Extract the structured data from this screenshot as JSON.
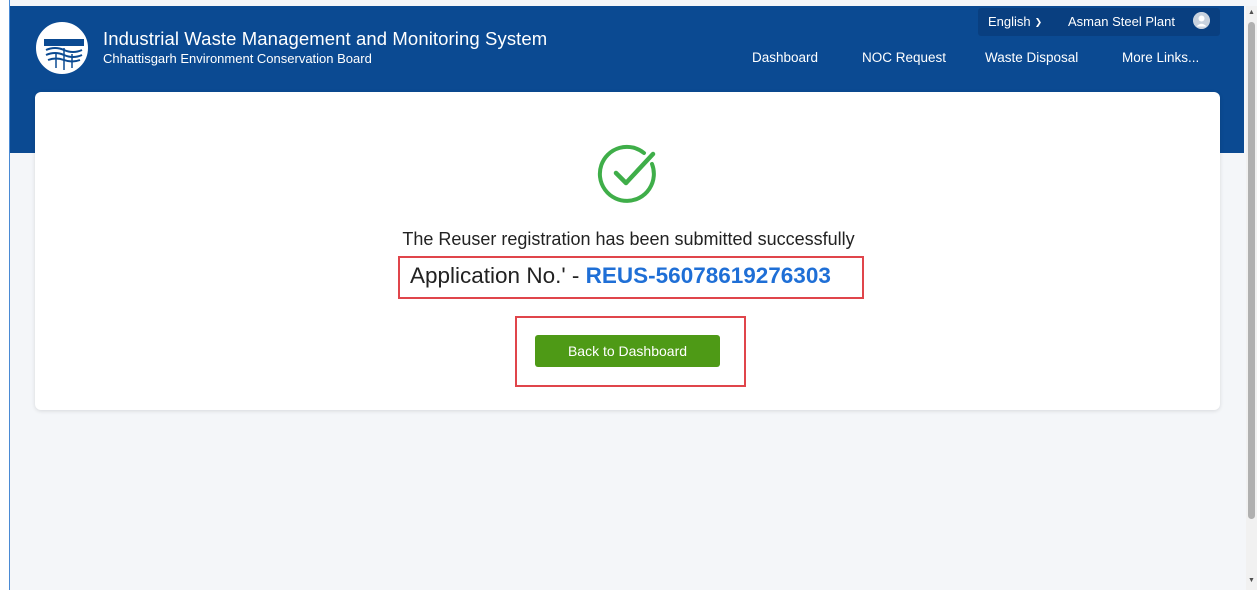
{
  "header": {
    "title": "Industrial Waste Management and Monitoring System",
    "subtitle": "Chhattisgarh Environment Conservation Board",
    "logo_icon": "cecb-logo-icon",
    "brand_color": "#0b4a92"
  },
  "top_bar": {
    "language": "English",
    "user_name": "Asman Steel Plant",
    "avatar_icon": "user-avatar-icon"
  },
  "nav": {
    "items": [
      "Dashboard",
      "NOC Request",
      "Waste Disposal",
      "More Links..."
    ]
  },
  "main": {
    "success_icon": "check-circle-icon",
    "success_color": "#3fae49",
    "message": "The Reuser registration has been submitted successfully",
    "application_label": "Application No.' -",
    "application_number": "REUS-56078619276303",
    "application_number_color": "#1f6fd6",
    "back_button_label": "Back to Dashboard",
    "button_color": "#4e9a16",
    "highlight_color": "#e0454b"
  }
}
